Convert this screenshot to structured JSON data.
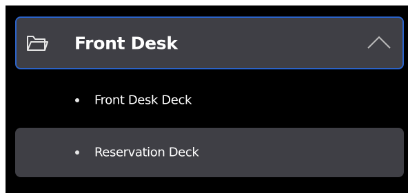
{
  "group": {
    "title": "Front Desk",
    "icon": "folder-icon",
    "toggle_icon": "chevron-up-icon",
    "expanded": true,
    "accent_color": "#2b63c9"
  },
  "decks": [
    {
      "label": "Front Desk Deck",
      "selected": false
    },
    {
      "label": "Reservation Deck",
      "selected": true
    }
  ]
}
